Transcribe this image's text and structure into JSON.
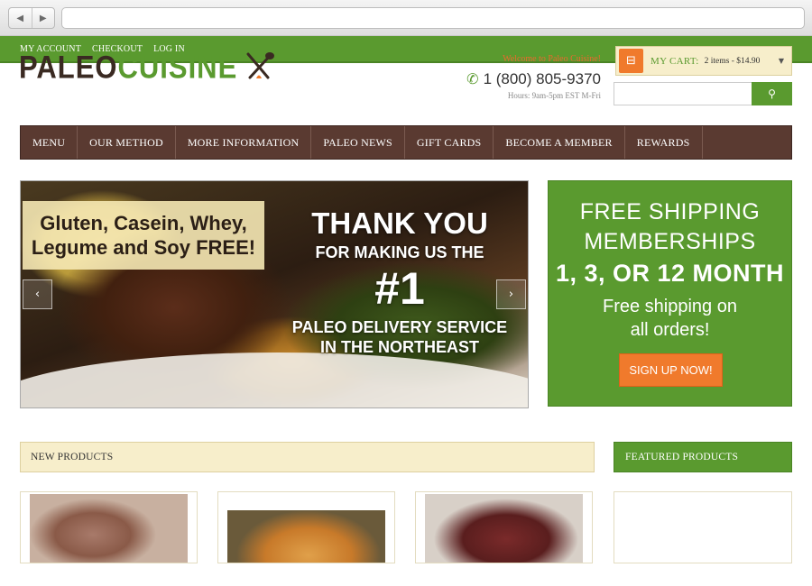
{
  "browser": {
    "back_icon": "back-arrow-icon",
    "forward_icon": "forward-arrow-icon",
    "address": ""
  },
  "topbar": {
    "links": [
      "MY ACCOUNT",
      "CHECKOUT",
      "LOG IN"
    ]
  },
  "header": {
    "logo_part1": "PALEO",
    "logo_part2": "CUISINE",
    "logo_icon": "crossed-utensils-icon",
    "welcome": "Welcome to Paleo Cuisine!",
    "phone": "1 (800) 805-9370",
    "hours": "Hours: 9am-5pm EST M-Fri"
  },
  "cart": {
    "label": "MY CART:",
    "summary": "2 items - $14.90"
  },
  "search": {
    "placeholder": ""
  },
  "nav": {
    "items": [
      "MENU",
      "OUR METHOD",
      "MORE INFORMATION",
      "PALEO NEWS",
      "GIFT CARDS",
      "BECOME A MEMBER",
      "REWARDS"
    ]
  },
  "hero": {
    "badge_line1": "Gluten, Casein, Whey,",
    "badge_line2": "Legume and Soy FREE!",
    "thanks": "THANK YOU",
    "making": "FOR MAKING US THE",
    "number": "#1",
    "service_line1": "PALEO DELIVERY SERVICE",
    "service_line2": "IN THE NORTHEAST"
  },
  "promo": {
    "line1": "FREE SHIPPING",
    "line2": "MEMBERSHIPS",
    "line3": "1, 3, OR 12 MONTH",
    "line4": "Free shipping on",
    "line5": "all orders!",
    "button": "SIGN UP NOW!"
  },
  "sections": {
    "new_products": "NEW PRODUCTS",
    "featured_products": "FEATURED PRODUCTS"
  },
  "colors": {
    "brand_green": "#5a9a2f",
    "nav_brown": "#5a3a31",
    "accent_orange": "#f07a2c",
    "cream": "#f7eecb"
  }
}
